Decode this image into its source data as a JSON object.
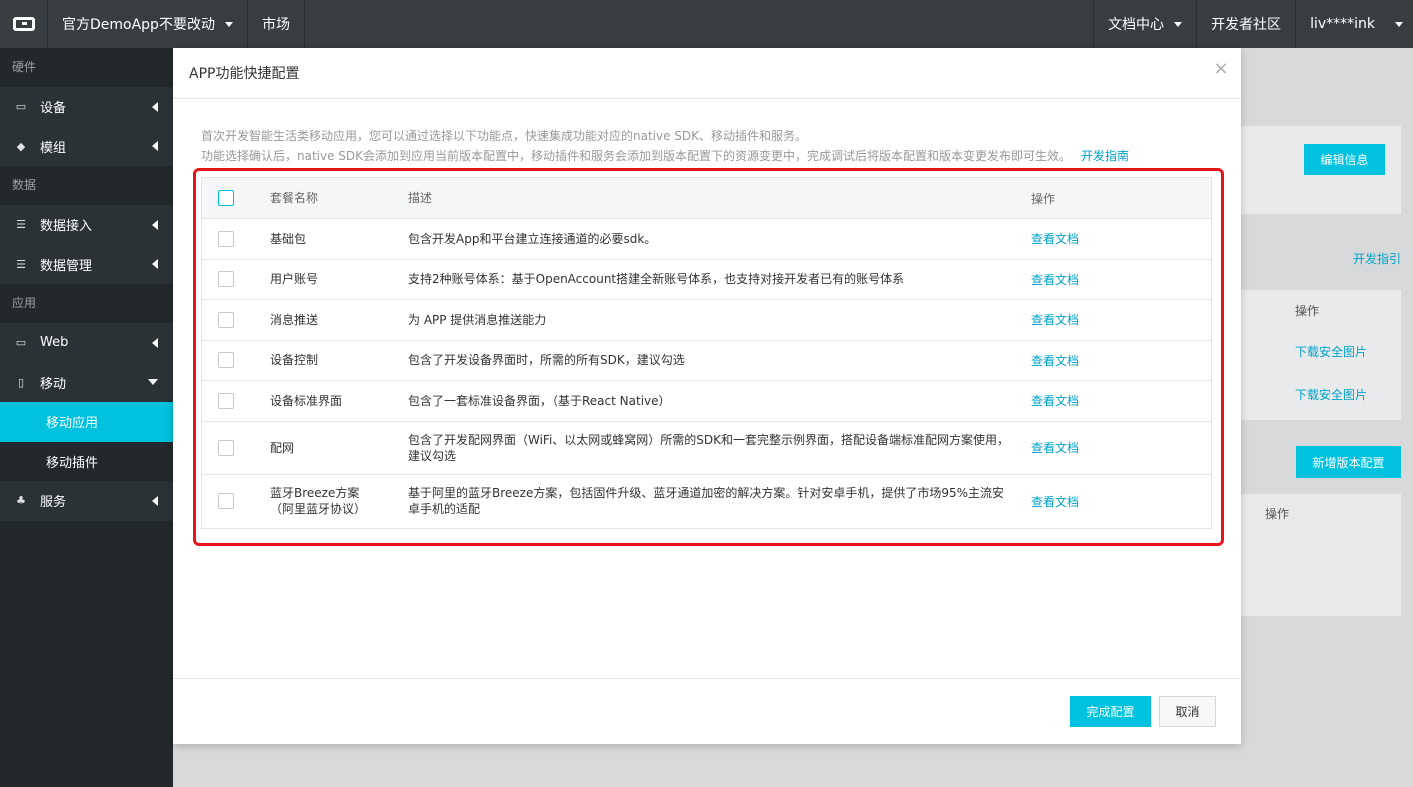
{
  "topbar": {
    "app_selector": "官方DemoApp不要改动",
    "market": "市场",
    "docs": "文档中心",
    "community": "开发者社区",
    "user": "liv****ink"
  },
  "sidebar": {
    "group_hardware": "硬件",
    "device": "设备",
    "module": "模组",
    "group_data": "数据",
    "data_access": "数据接入",
    "data_manage": "数据管理",
    "group_app": "应用",
    "web": "Web",
    "mobile": "移动",
    "mobile_app": "移动应用",
    "mobile_plugin": "移动插件",
    "service": "服务"
  },
  "background": {
    "edit_info": "编辑信息",
    "dev_guide": "开发指引",
    "op_header": "操作",
    "download_1": "下载安全图片",
    "download_2": "下载安全图片",
    "new_version": "新增版本配置",
    "op_header_2": "操作"
  },
  "modal": {
    "title": "APP功能快捷配置",
    "intro_line1": "首次开发智能生活类移动应用，您可以通过选择以下功能点，快速集成功能对应的native SDK、移动插件和服务。",
    "intro_line2": "功能选择确认后，native SDK会添加到应用当前版本配置中，移动插件和服务会添加到版本配置下的资源变更中，完成调试后将版本配置和版本变更发布即可生效。",
    "intro_link": "开发指南",
    "table": {
      "headers": {
        "name": "套餐名称",
        "desc": "描述",
        "op": "操作"
      },
      "rows": [
        {
          "name": "基础包",
          "desc": "包含开发App和平台建立连接通道的必要sdk。",
          "op": "查看文档"
        },
        {
          "name": "用户账号",
          "desc": "支持2种账号体系：基于OpenAccount搭建全新账号体系，也支持对接开发者已有的账号体系",
          "op": "查看文档"
        },
        {
          "name": "消息推送",
          "desc": "为 APP 提供消息推送能力",
          "op": "查看文档"
        },
        {
          "name": "设备控制",
          "desc": "包含了开发设备界面时，所需的所有SDK，建议勾选",
          "op": "查看文档"
        },
        {
          "name": "设备标准界面",
          "desc": "包含了一套标准设备界面，（基于React Native）",
          "op": "查看文档"
        },
        {
          "name": "配网",
          "desc": "包含了开发配网界面（WiFi、以太网或蜂窝网）所需的SDK和一套完整示例界面，搭配设备端标准配网方案使用，建议勾选",
          "op": "查看文档"
        },
        {
          "name": "蓝牙Breeze方案（阿里蓝牙协议）",
          "desc": "基于阿里的蓝牙Breeze方案，包括固件升级、蓝牙通道加密的解决方案。针对安卓手机，提供了市场95%主流安卓手机的适配",
          "op": "查看文档"
        }
      ]
    },
    "confirm_button": "完成配置",
    "cancel_button": "取消"
  },
  "colors": {
    "accent": "#00c1de",
    "link": "#00a2ca",
    "highlight": "#e4161b",
    "topbar": "#373d41",
    "sidebar": "#22282b"
  }
}
